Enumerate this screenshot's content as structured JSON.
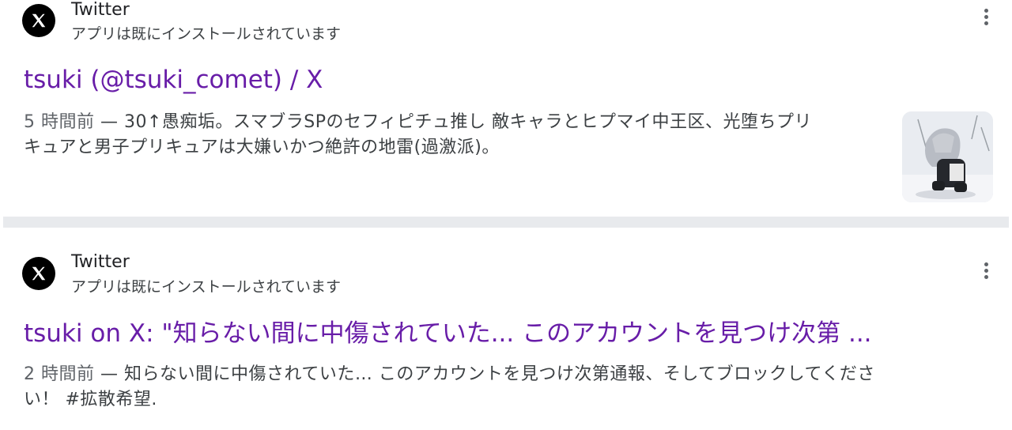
{
  "results": [
    {
      "site_name": "Twitter",
      "site_sub": "アプリは既にインストールされています",
      "title": "tsuki (@tsuki_comet) / X",
      "date": "5 時間前",
      "separator": " — ",
      "snippet_line1": "30↑愚痴垢。スマブラSPのセフィピチュ推し 敵キャラとヒプマイ中王区、光堕ちプリ",
      "snippet_line2": "キュアと男子プリキュアは大嫌いかつ絶許の地雷(過激派)。",
      "icon": "x-logo-icon",
      "has_thumbnail": true
    },
    {
      "site_name": "Twitter",
      "site_sub": "アプリは既にインストールされています",
      "title": "tsuki on X: \"知らない間に中傷されていた... このアカウントを見つけ次第 ...",
      "date": "2 時間前",
      "separator": " — ",
      "snippet_line1": "知らない間に中傷されていた… このアカウントを見つけ次第通報、そしてブロックしてくださ",
      "snippet_line2": "い！ #拡散希望.",
      "icon": "x-logo-icon",
      "has_thumbnail": false
    }
  ],
  "colors": {
    "link_visited": "#681da8",
    "text": "#202124",
    "snippet": "#3c4043",
    "divider": "#e8eaed"
  }
}
